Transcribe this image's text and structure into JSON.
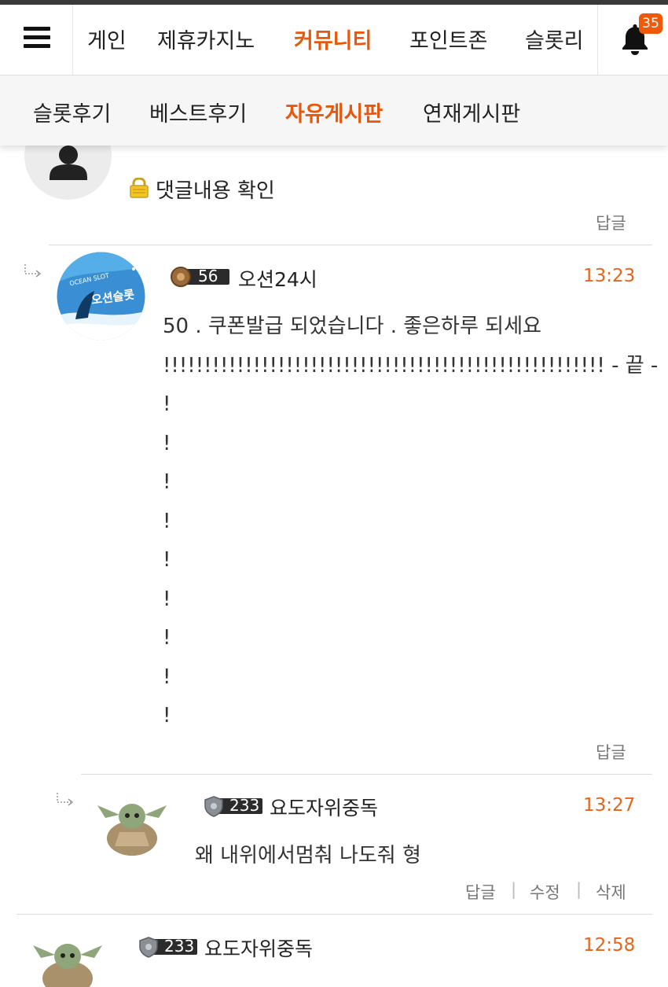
{
  "top_nav": {
    "items": [
      {
        "label": "게인",
        "active": false
      },
      {
        "label": "제휴카지노",
        "active": false
      },
      {
        "label": "커뮤니티",
        "active": true
      },
      {
        "label": "포인트존",
        "active": false
      },
      {
        "label": "슬롯리",
        "active": false
      }
    ],
    "notification_count": "35"
  },
  "sub_nav": {
    "items": [
      {
        "label": "슬롯후기",
        "active": false
      },
      {
        "label": "베스트후기",
        "active": false
      },
      {
        "label": "자유게시판",
        "active": true
      },
      {
        "label": "연재게시판",
        "active": false
      }
    ]
  },
  "comments": [
    {
      "locked_text": "댓글내용 확인",
      "reply_label": "답글"
    },
    {
      "level": "56",
      "nickname": "오션24시",
      "time": "13:23",
      "avatar_text": "오션슬롯",
      "avatar_small": "OCEAN SLOT",
      "body": "50 . 쿠폰발급 되었습니다 . 좋은하루 되세요\n!!!!!!!!!!!!!!!!!!!!!!!!!!!!!!!!!!!!!!!!!!!!!!!!!!!!!! - 끝 -\n!\n!\n!\n!\n!\n!\n!\n!\n!",
      "reply_label": "답글"
    },
    {
      "level": "233",
      "nickname": "요도자위중독",
      "time": "13:27",
      "body": "왜 내위에서멈춰 나도줘 형",
      "reply_label": "답글",
      "edit_label": "수정",
      "delete_label": "삭제"
    },
    {
      "level": "233",
      "nickname": "요도자위중독",
      "time": "12:58"
    }
  ],
  "colors": {
    "accent": "#e8580c",
    "time": "#e4661c",
    "badge": "#ef5a0a"
  }
}
